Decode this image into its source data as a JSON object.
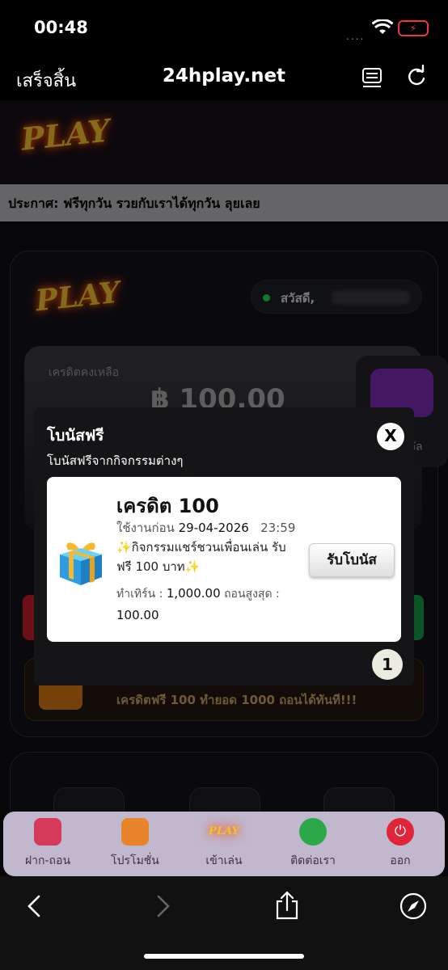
{
  "status_bar": {
    "time": "00:48",
    "dots": "....",
    "battery_icon": "battery-charging-low-icon",
    "wifi_icon": "wifi-icon"
  },
  "browser": {
    "done_label": "เสร็จสิ้น",
    "url": "24hplay.net",
    "reader_icon": "reader-icon",
    "reload_icon": "reload-icon"
  },
  "site": {
    "logo_text": "PLAY",
    "announcement": "ประกาศ:  ฟรีทุกวัน รวยกับเราได้ทุกวัน ลุยเลย",
    "greeting": "สวัสดี,",
    "credit_label": "เครดิตคงเหลือ",
    "credit_value": "฿ 100.00",
    "side_label": "วัล",
    "promo_text": "เครดิตฟรี 100 ทำยอด 1000 ถอนได้ทันที!!!"
  },
  "modal": {
    "title": "โบนัสฟรี",
    "subtitle": "โบนัสฟรีจากกิจกรรมต่างๆ",
    "close_label": "X",
    "card": {
      "title": "เครดิต 100",
      "use_before_label": "ใช้งานก่อน",
      "date": "29-04-2026",
      "time": "23:59",
      "description": "✨กิจกรรมแชร์ชวนเพื่อนเล่น รับฟรี 100 บาท✨",
      "turnover_label": "ทำเทิร์น :",
      "turnover_value": "1,000.00",
      "max_withdraw_label": "ถอนสูงสุด :",
      "max_withdraw_value": "100.00",
      "claim_label": "รับโบนัส"
    },
    "page_number": "1"
  },
  "bottom_nav": [
    {
      "label": "ฝาก-ถอน",
      "icon": "wallet-icon",
      "color": "#d63a5a"
    },
    {
      "label": "โปรโมชั่น",
      "icon": "promotion-gift-icon",
      "color": "#e8852a"
    },
    {
      "label": "เข้าเล่น",
      "icon": "play-logo-icon",
      "color": "#e6b300"
    },
    {
      "label": "ติดต่อเรา",
      "icon": "chat-icon",
      "color": "#2ba84a"
    },
    {
      "label": "ออก",
      "icon": "power-icon",
      "color": "#e0243a"
    }
  ],
  "toolbar": {
    "back_icon": "back-icon",
    "forward_icon": "forward-icon",
    "share_icon": "share-icon",
    "safari_icon": "compass-icon"
  }
}
